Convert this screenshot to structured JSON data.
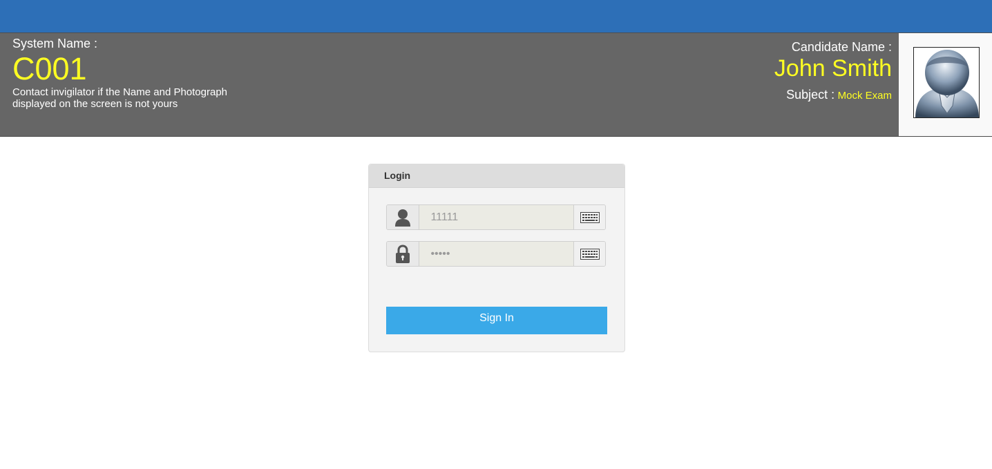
{
  "header": {
    "system_label": "System Name :",
    "system_value": "C001",
    "note": "Contact invigilator if the Name and Photograph displayed on the screen is not yours",
    "candidate_label": "Candidate Name :",
    "candidate_value": "John Smith",
    "subject_label": "Subject :",
    "subject_value": "Mock Exam"
  },
  "login": {
    "title": "Login",
    "username_placeholder": "11111",
    "password_placeholder": "•••••",
    "signin_label": "Sign In"
  },
  "icons": {
    "user": "user-icon",
    "lock": "lock-icon",
    "keyboard": "keyboard-icon",
    "avatar": "candidate-photo"
  },
  "colors": {
    "topbar": "#2d6fb7",
    "header_bg": "#666666",
    "highlight": "#ffff22",
    "signin": "#3aa9e8"
  }
}
